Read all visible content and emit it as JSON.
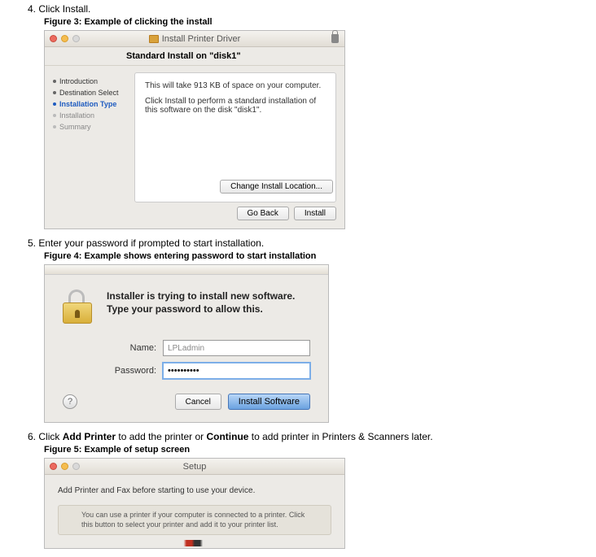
{
  "steps": {
    "s4": {
      "num": "4.",
      "text": "Click Install.",
      "caption": "Figure 3: Example of clicking the install"
    },
    "s5": {
      "num": "5.",
      "text": "Enter your password if prompted to start installation.",
      "caption": "Figure 4: Example shows entering password to start installation"
    },
    "s6": {
      "num": "6.",
      "text_a": "Click ",
      "bold_a": "Add Printer",
      "text_b": " to add the printer or ",
      "bold_b": "Continue",
      "text_c": " to add printer in Printers & Scanners later.",
      "caption": "Figure 5: Example of setup screen"
    }
  },
  "fig3": {
    "title": "Install Printer Driver",
    "subheader": "Standard Install on \"disk1\"",
    "sidebar": {
      "i0": "Introduction",
      "i1": "Destination Select",
      "i2": "Installation Type",
      "i3": "Installation",
      "i4": "Summary"
    },
    "body_line1": "This will take 913 KB of space on your computer.",
    "body_line2": "Click Install to perform a standard installation of this software on the disk \"disk1\".",
    "change_location": "Change Install Location...",
    "go_back": "Go Back",
    "install": "Install"
  },
  "fig4": {
    "message": "Installer is trying to install new software. Type your password to allow this.",
    "name_label": "Name:",
    "name_value": "LPLadmin",
    "password_label": "Password:",
    "password_value": "••••••••••",
    "help": "?",
    "cancel": "Cancel",
    "install_software": "Install Software"
  },
  "fig5": {
    "title": "Setup",
    "headline": "Add Printer and Fax before starting to use your device.",
    "note": "You can use a printer if your computer is connected to a printer. Click this button to select your printer and add it to your printer list."
  }
}
